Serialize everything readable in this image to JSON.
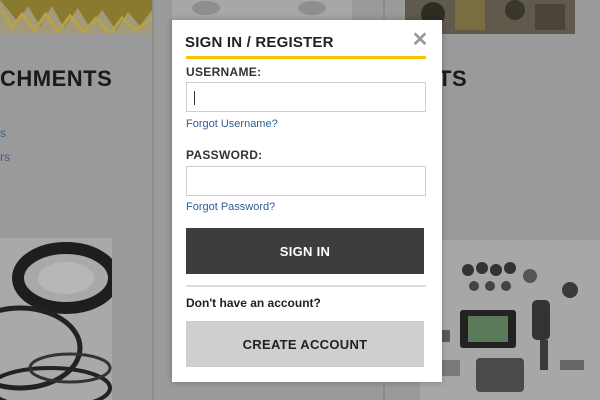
{
  "background": {
    "left_heading": "CHMENTS",
    "right_heading": "TS",
    "left_links": [
      "s",
      "rs"
    ]
  },
  "modal": {
    "title": "SIGN IN / REGISTER",
    "close_glyph": "✕",
    "username": {
      "label": "USERNAME:",
      "value": "",
      "forgot_link": "Forgot Username?"
    },
    "password": {
      "label": "PASSWORD:",
      "value": "",
      "forgot_link": "Forgot Password?"
    },
    "signin_button": "SIGN IN",
    "no_account_text": "Don't have an account?",
    "create_button": "CREATE ACCOUNT",
    "accent_color": "#f5c400"
  }
}
